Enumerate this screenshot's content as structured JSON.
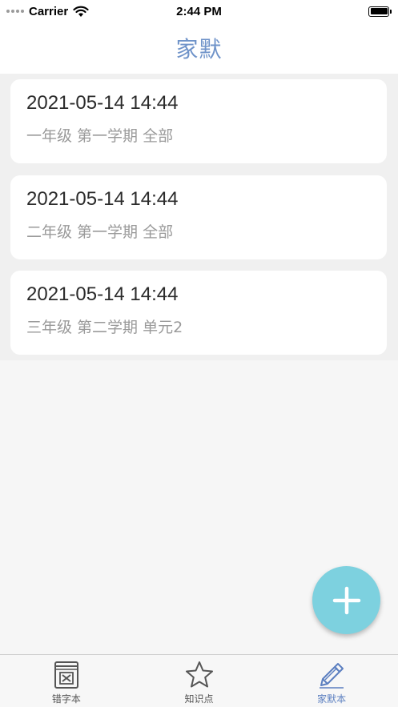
{
  "status_bar": {
    "carrier": "Carrier",
    "time": "2:44 PM"
  },
  "nav": {
    "title": "家默"
  },
  "records": [
    {
      "datetime": "2021-05-14 14:44",
      "detail": "一年级 第一学期 全部"
    },
    {
      "datetime": "2021-05-14 14:44",
      "detail": "二年级 第一学期 全部"
    },
    {
      "datetime": "2021-05-14 14:44",
      "detail": "三年级 第二学期 单元2"
    }
  ],
  "fab": {
    "icon": "plus-icon"
  },
  "tabs": [
    {
      "label": "错字本",
      "icon": "wrong-book-icon",
      "active": false
    },
    {
      "label": "知识点",
      "icon": "star-icon",
      "active": false
    },
    {
      "label": "家默本",
      "icon": "pencil-icon",
      "active": true
    }
  ],
  "colors": {
    "accent": "#6f93c9",
    "active_tab": "#5b7fc0",
    "fab": "#7dd1df"
  }
}
